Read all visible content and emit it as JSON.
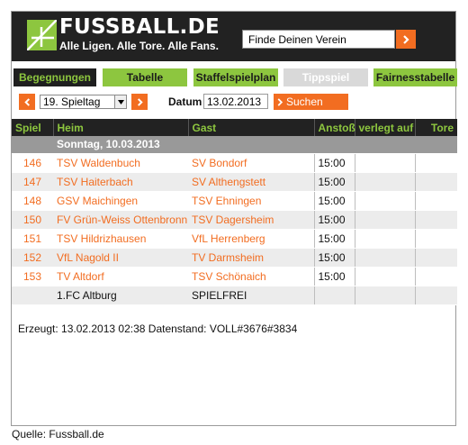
{
  "header": {
    "title": "FUSSBALL.DE",
    "tagline": "Alle Ligen. Alle Tore. Alle Fans.",
    "search_placeholder": "Finde Deinen Verein",
    "brand_color": "#8dc63f",
    "accent_color": "#f26d21"
  },
  "tabs": [
    {
      "label": "Begegnungen",
      "state": "active"
    },
    {
      "label": "Tabelle",
      "state": "normal"
    },
    {
      "label": "Staffelspielplan",
      "state": "normal"
    },
    {
      "label": "Tippspiel",
      "state": "disabled"
    },
    {
      "label": "Fairnesstabelle",
      "state": "normal"
    }
  ],
  "controls": {
    "matchday_selected": "19. Spieltag",
    "date_label": "Datum",
    "date_value": "13.02.2013",
    "search_button": "Suchen"
  },
  "table": {
    "columns": [
      "Spiel",
      "Heim",
      "Gast",
      "Anstoß",
      "verlegt auf",
      "Tore"
    ],
    "date_row": "Sonntag, 10.03.2013",
    "rows": [
      {
        "nr": "146",
        "home": "TSV Waldenbuch",
        "away": "SV Bondorf",
        "time": "15:00"
      },
      {
        "nr": "147",
        "home": "TSV Haiterbach",
        "away": "SV Althengstett",
        "time": "15:00"
      },
      {
        "nr": "148",
        "home": "GSV Maichingen",
        "away": "TSV Ehningen",
        "time": "15:00"
      },
      {
        "nr": "150",
        "home": "FV Grün-Weiss Ottenbronn",
        "away": "TSV Dagersheim",
        "time": "15:00"
      },
      {
        "nr": "151",
        "home": "TSV Hildrizhausen",
        "away": "VfL Herrenberg",
        "time": "15:00"
      },
      {
        "nr": "152",
        "home": "VfL Nagold II",
        "away": "TV Darmsheim",
        "time": "15:00"
      },
      {
        "nr": "153",
        "home": "TV Altdorf",
        "away": "TSV Schönaich",
        "time": "15:00"
      },
      {
        "nr": "",
        "home": "1.FC Altburg",
        "away": "SPIELFREI",
        "time": ""
      }
    ]
  },
  "footer": {
    "generated": "Erzeugt: 13.02.2013 02:38 Datenstand: VOLL#3676#3834"
  },
  "caption": "Quelle: Fussball.de"
}
